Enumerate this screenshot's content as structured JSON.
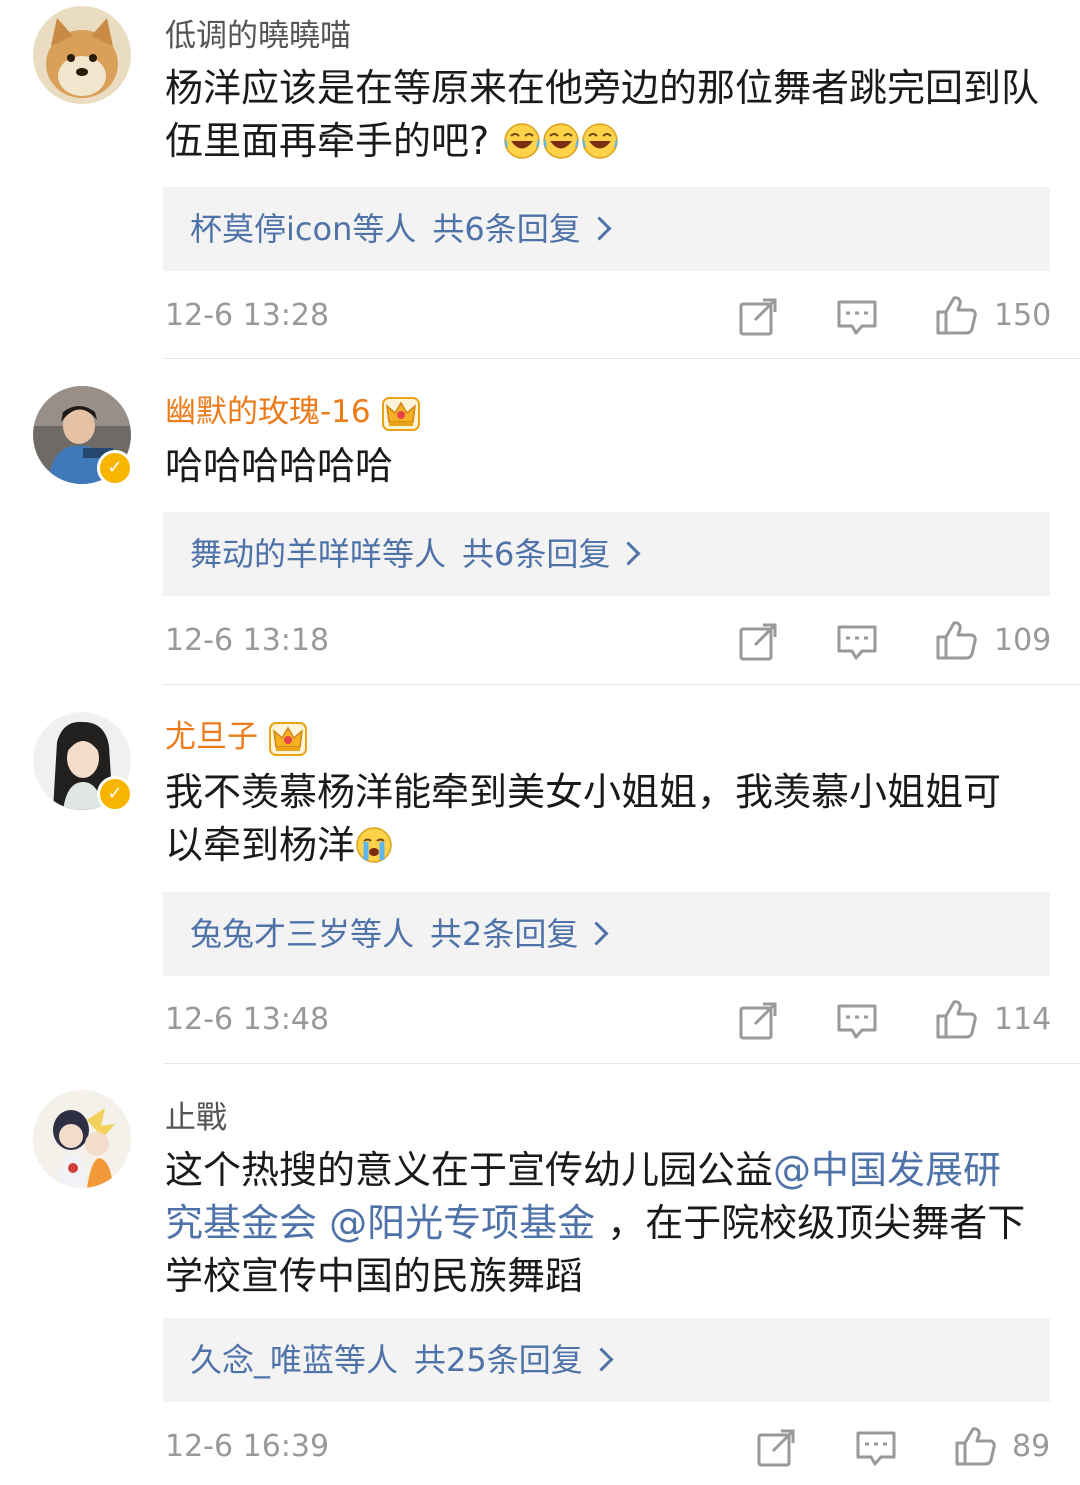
{
  "comments": [
    {
      "username": "低调的曉曉喵",
      "text": "杨洋应该是在等原来在他旁边的那位舞者跳完回到队伍里面再牵手的吧?",
      "emojis": [
        "laugh-cry-emoji",
        "laugh-cry-emoji",
        "laugh-cry-emoji"
      ],
      "reply_names": "杯莫停icon等人",
      "reply_count": "共6条回复",
      "time": "12-6 13:28",
      "likes": "150"
    },
    {
      "username": "幽默的玫瑰-16",
      "text": "哈哈哈哈哈哈",
      "reply_names": "舞动的羊咩咩等人",
      "reply_count": "共6条回复",
      "time": "12-6 13:18",
      "likes": "109"
    },
    {
      "username": "尤旦子",
      "text_line1": "我不羡慕杨洋能牵到美女小姐姐，我羡慕小姐姐可",
      "text_line2": "以牵到杨洋",
      "emojis": [
        "crying-emoji"
      ],
      "reply_names": "兔兔才三岁等人",
      "reply_count": "共2条回复",
      "time": "12-6 13:48",
      "likes": "114"
    },
    {
      "username": "止戰",
      "mention1a": "@中国发展研",
      "mention1b": "究基金会",
      "mention2": "@阳光专项基金",
      "text_pre": "这个热搜的意义在于宣传幼儿园公益",
      "text_mid": "，在于院校级顶尖舞者下",
      "text_end": "学校宣传中国的民族舞蹈",
      "reply_names": "久念_唯蓝等人",
      "reply_count": "共25条回复",
      "time": "12-6 16:39",
      "likes": "89"
    }
  ],
  "colors": {
    "link": "#4f73a8",
    "vip_name": "#ec7b1a",
    "meta": "#999999",
    "reply_bg": "#f3f3f3"
  },
  "icons": [
    "share-icon",
    "comment-icon",
    "like-icon",
    "crown-icon",
    "verified-icon"
  ]
}
